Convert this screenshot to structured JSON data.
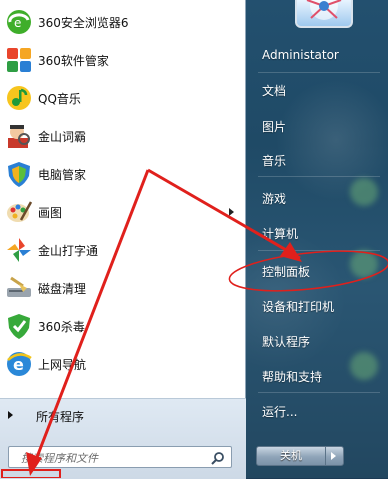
{
  "start_menu": {
    "programs": [
      {
        "label": "360安全浏览器6",
        "icon": "browser-360-icon"
      },
      {
        "label": "360软件管家",
        "icon": "software-manager-icon"
      },
      {
        "label": "QQ音乐",
        "icon": "qq-music-icon"
      },
      {
        "label": "金山词霸",
        "icon": "dictionary-icon"
      },
      {
        "label": "电脑管家",
        "icon": "pc-manager-icon"
      },
      {
        "label": "画图",
        "icon": "paint-icon"
      },
      {
        "label": "金山打字通",
        "icon": "typing-icon"
      },
      {
        "label": "磁盘清理",
        "icon": "disk-cleanup-icon"
      },
      {
        "label": "360杀毒",
        "icon": "antivirus-icon"
      },
      {
        "label": "上网导航",
        "icon": "ie-icon"
      }
    ],
    "all_programs": "所有程序",
    "search_placeholder": "搜索程序和文件",
    "right_items": [
      "Administator",
      "文档",
      "图片",
      "音乐",
      "游戏",
      "计算机",
      "控制面板",
      "设备和打印机",
      "默认程序",
      "帮助和支持",
      "运行..."
    ],
    "shutdown_label": "关机"
  },
  "colors": {
    "annotation": "#e0201c"
  }
}
